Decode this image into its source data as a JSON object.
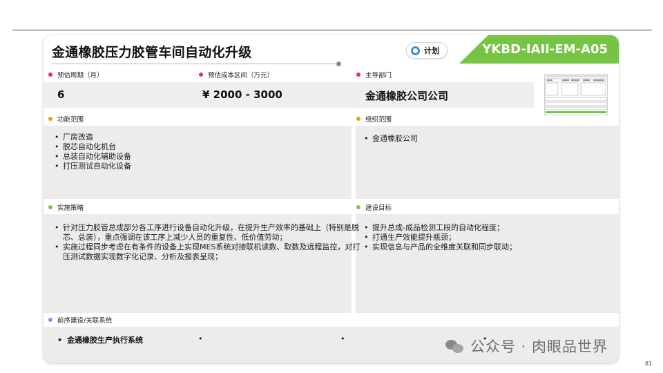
{
  "header": {
    "title": "金通橡胶压力胶管车间自动化升级",
    "status_label": "计划",
    "project_code": "YKBD-IAII-EM-A05"
  },
  "fields": {
    "duration_label": "预估周期（月）",
    "duration_value": "6",
    "cost_label": "预估成本区间（万元）",
    "cost_value": "¥ 2000 - 3000",
    "dept_label": "主导部门",
    "dept_value": "金通橡胶公司公司"
  },
  "scope": {
    "function_label": "功能范围",
    "function_items": [
      "厂房改造",
      "脱芯自动化机台",
      "总装自动化辅助设备",
      "打压测试自动化设备"
    ],
    "org_label": "组织范围",
    "org_items": [
      "金通橡胶公司"
    ]
  },
  "strategy": {
    "label": "实施策略",
    "items": [
      "针对压力胶管总成部分各工序进行设备自动化升级，在提升生产效率的基础上（特别是脱芯、总装），重点强调在该工序上减少人员的重复性、低价值劳动；",
      "实施过程同步考虑在有条件的设备上实现MES系统对接联机读数、取数及远程监控，对打压测试数据实现数字化记录、分析及报表呈现；"
    ]
  },
  "goals": {
    "label": "建设目标",
    "items": [
      "提升总成-成品检测工段的自动化程度；",
      "打通生产效能提升瓶颈；",
      "实现信息与产品的全维度关联和同步联动；"
    ]
  },
  "related": {
    "label": "前序建设/关联系统",
    "item1": "金通橡胶生产执行系统"
  },
  "watermark": "公众号 · 肉眼品世界",
  "page_number": "81",
  "colors": {
    "red_dot": "#e0334a",
    "orange_dot": "#f29a1d",
    "green_dot": "#7ec44a",
    "purple_dot": "#b07ee0",
    "accent_green": "#77c444",
    "status_blue": "#3b8fd6"
  }
}
